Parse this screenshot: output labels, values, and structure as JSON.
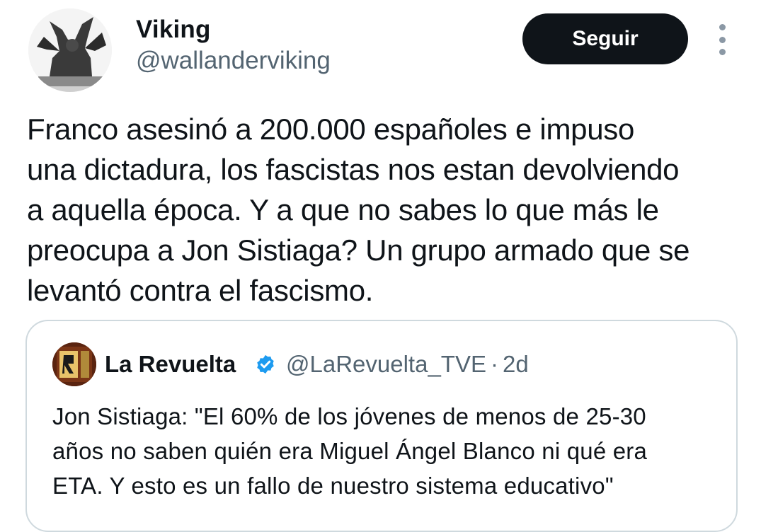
{
  "author": {
    "display_name": "Viking",
    "handle": "@wallanderviking",
    "avatar_icon": "gargoyle-statue-avatar"
  },
  "actions": {
    "follow_label": "Seguir",
    "more_icon": "more-vertical-icon"
  },
  "tweet": {
    "text": "Franco asesinó a 200.000 españoles e impuso\nuna dictadura, los fascistas nos estan devolviendo\na aquella época. Y a que no sabes lo que más le\npreocupa a Jon Sistiaga? Un grupo armado que se\nlevantó contra el fascismo."
  },
  "quoted_tweet": {
    "display_name": "La Revuelta",
    "verified": true,
    "handle": "@LaRevuelta_TVE",
    "separator": "·",
    "time": "2d",
    "text": "Jon Sistiaga: \"El 60% de los jóvenes de menos de 25-30\naños no saben quién era Miguel Ángel Blanco ni qué era\nETA. Y esto es un fallo de nuestro sistema educativo\"",
    "avatar_icon": "la-revuelta-logo-avatar"
  },
  "colors": {
    "text": "#0f1419",
    "secondary": "#536471",
    "button_bg": "#0f1419",
    "verified": "#1d9bf0",
    "border": "#cfd9de"
  }
}
